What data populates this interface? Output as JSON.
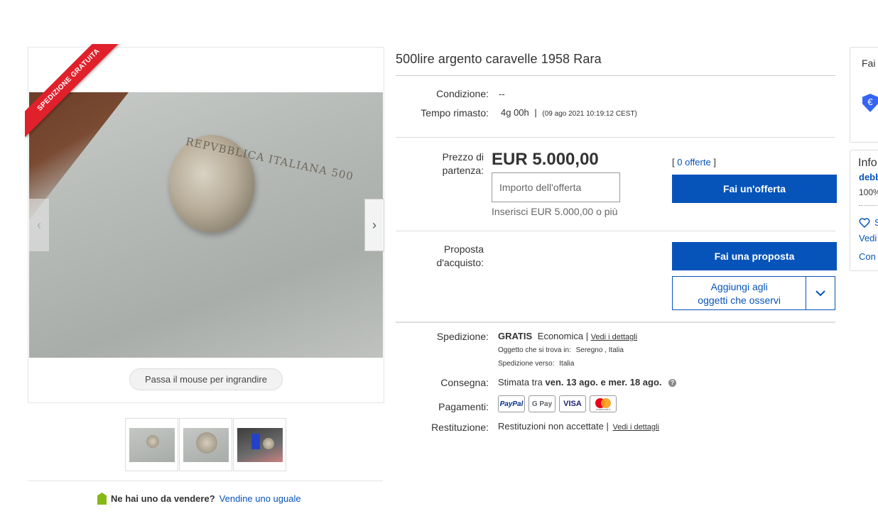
{
  "listing": {
    "title": "500lire argento caravelle 1958 Rara",
    "ribbon": "SPEDIZIONE GRATUITA",
    "zoom_hint": "Passa il mouse per ingrandire",
    "coin_inscription": "REPVBBLICA ITALIANA 500"
  },
  "details": {
    "condition_label": "Condizione:",
    "condition_value": "--",
    "time_label": "Tempo rimasto:",
    "time_value": "4g 00h",
    "time_sep": "|",
    "time_end": "(09 ago 2021   10:19:12 CEST)"
  },
  "bid": {
    "label_line1": "Prezzo di",
    "label_line2": "partenza:",
    "price": "EUR 5.000,00",
    "input_placeholder": "Importo dell'offerta",
    "hint": "Inserisci EUR 5.000,00 o più",
    "offers_open": "[",
    "offers_link": "0 offerte",
    "offers_close": "]",
    "button": "Fai un'offerta"
  },
  "offer": {
    "label_line1": "Proposta",
    "label_line2": "d'acquisto:",
    "button": "Fai una proposta",
    "watch_line1": "Aggiungi agli",
    "watch_line2": "oggetti che osservi"
  },
  "shipping": {
    "label": "Spedizione:",
    "free": "GRATIS",
    "method": "Economica |",
    "details_link": "Vedi i dettagli",
    "location_label": "Oggetto che si trova in:",
    "location": "Seregno , Italia",
    "dest_label": "Spedizione verso:",
    "dest": "Italia"
  },
  "delivery": {
    "label": "Consegna:",
    "prefix": "Stimata tra",
    "dates": "ven. 13 ago. e mer. 18 ago."
  },
  "payments": {
    "label": "Pagamenti:",
    "methods": [
      "PayPal",
      "G Pay",
      "VISA",
      "mastercard"
    ]
  },
  "returns": {
    "label": "Restituzione:",
    "value": "Restituzioni non accettate |",
    "details_link": "Vedi i dettagli"
  },
  "sell": {
    "question": "Ne hai uno da vendere?",
    "link": "Vendine uno uguale"
  },
  "sidebar": {
    "box1_title": "Fai",
    "box2_title": "Info",
    "seller": "debb",
    "feedback": "100%",
    "save": "S",
    "see": "Vedi",
    "contact": "Con"
  },
  "colors": {
    "accent": "#0654ba",
    "ribbon": "#e0202a",
    "tag": "#86b817"
  }
}
